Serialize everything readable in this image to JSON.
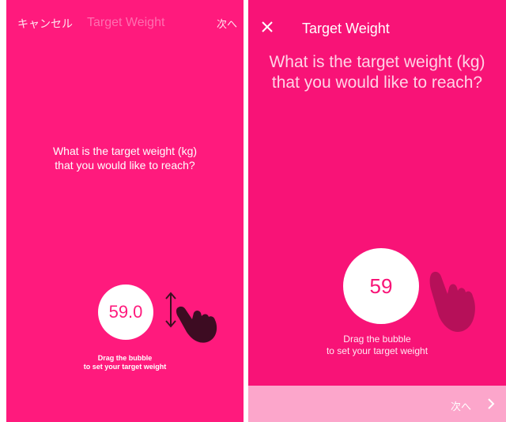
{
  "left": {
    "cancel_label": "キャンセル",
    "title": "Target Weight",
    "next_label": "次へ",
    "question_line1": "What is the target weight (kg)",
    "question_line2": "that you would like to reach?",
    "bubble_value": "59.0",
    "hint_line1": "Drag the bubble",
    "hint_line2": "to set your target weight",
    "icons": [
      "vertical-drag-arrow-icon",
      "hand-pointer-icon"
    ]
  },
  "right": {
    "close_icon": "close-icon",
    "title": "Target Weight",
    "question_line1": "What is the target weight (kg)",
    "question_line2": "that you would like to reach?",
    "bubble_value": "59",
    "hint_line1": "Drag the bubble",
    "hint_line2": "to set your target weight",
    "next_label": "次へ",
    "icons": [
      "hand-pointer-icon",
      "chevron-right-icon"
    ]
  },
  "colors": {
    "accent_left": "#ff1a7d",
    "accent_right": "#f81377",
    "bottom_bar": "#fca6cb",
    "white": "#ffffff"
  }
}
